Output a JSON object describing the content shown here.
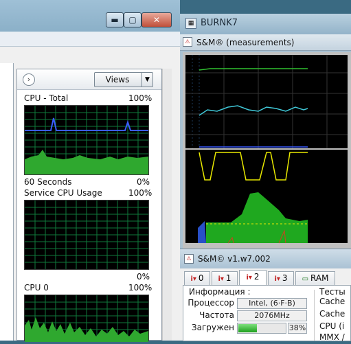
{
  "left_window": {
    "views_label": "Views",
    "graphs": [
      {
        "title": "CPU - Total",
        "max_label": "100%",
        "footer_left": "60 Seconds",
        "footer_right": "0%"
      },
      {
        "title": "Service CPU Usage",
        "max_label": "100%",
        "footer_right": "0%"
      },
      {
        "title": "CPU 0",
        "max_label": "100%"
      }
    ]
  },
  "burn_window": {
    "title": "BURNK7",
    "sm_title": "S&M® (measurements)"
  },
  "dialog": {
    "title": "S&M© v1.w7.002",
    "tabs": [
      {
        "label": "0"
      },
      {
        "label": "1"
      },
      {
        "label": "2"
      },
      {
        "label": "3"
      },
      {
        "label": "RAM"
      }
    ],
    "info_header": "Информация :",
    "processor_label": "Процессор",
    "processor_value": "Intel, (6·F·B)",
    "freq_label": "Частота",
    "freq_value": "2076MHz",
    "load_label": "Загружен",
    "load_value": "38%",
    "load_fraction": 0.38,
    "tests_header": "Тесты",
    "tests": [
      "Cache",
      "Cache",
      "CPU (i",
      "MMX /"
    ]
  },
  "colors": {
    "graph_grid": "#0f7a3c",
    "cpu_fill": "#2fa82f",
    "cpu_freq_line": "#3a5cff",
    "burn_green": "#1fa81f",
    "burn_yellow": "#e8e800",
    "burn_cyan": "#40c8d8"
  }
}
